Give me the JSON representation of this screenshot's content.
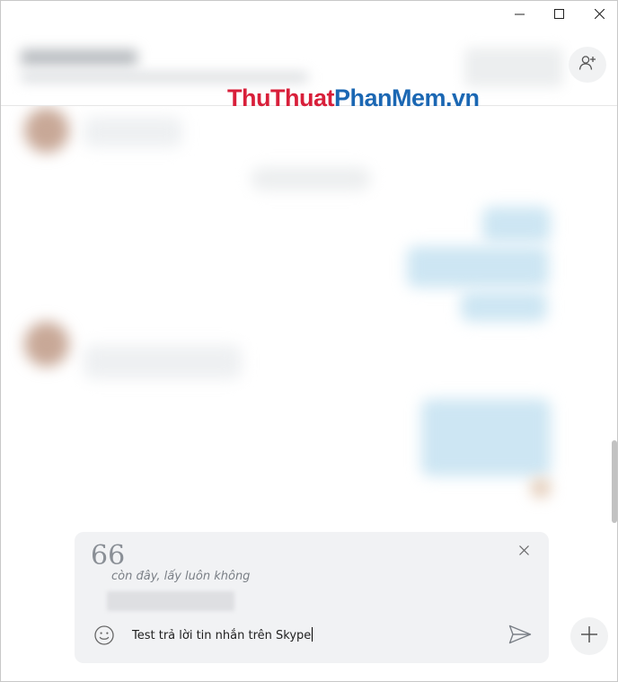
{
  "titlebar": {
    "minimize_icon": "minimize-icon",
    "maximize_icon": "maximize-icon",
    "close_icon": "close-icon"
  },
  "header": {
    "add_contact_icon": "add-person-icon"
  },
  "watermark": {
    "part1": "ThuThuat",
    "part2": "PhanMem.vn",
    "color1": "#d81f3a",
    "color2": "#1b67b3"
  },
  "composer": {
    "quote": {
      "icon": "quote-icon",
      "glyph": "66",
      "text": "còn đây, lấy luôn không",
      "close_icon": "close-icon"
    },
    "message_value": "Test trả lời tin nhắn trên Skype",
    "emoji_icon": "smiley-icon",
    "send_icon": "send-icon"
  },
  "plus_button_icon": "plus-icon",
  "colors": {
    "composer_bg": "#f1f2f4",
    "outgoing_bubble": "#cde6f3",
    "text_muted": "#7a7f86"
  }
}
